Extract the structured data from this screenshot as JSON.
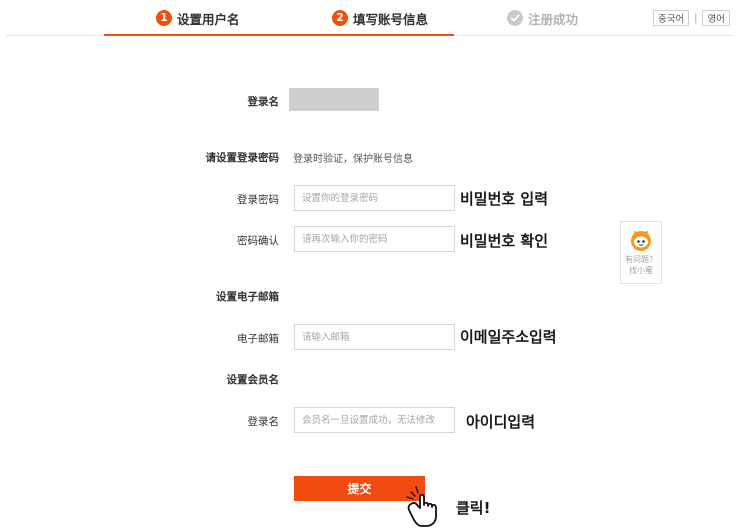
{
  "steps": [
    {
      "number": "1",
      "label": "设置用户名"
    },
    {
      "number": "2",
      "label": "填写账号信息"
    },
    {
      "label": "注册成功"
    }
  ],
  "language": {
    "option1": "중국어",
    "option2": "영어",
    "separator": "|"
  },
  "form": {
    "login_name_label": "登录名",
    "password_section_label": "请设置登录密码",
    "password_section_hint": "登录时验证，保护账号信息",
    "password_label": "登录密码",
    "password_placeholder": "设置你的登录密码",
    "confirm_label": "密码确认",
    "confirm_placeholder": "请再次输入你的密码",
    "email_section_label": "设置电子邮箱",
    "email_label": "电子邮箱",
    "email_placeholder": "请输入邮箱",
    "member_section_label": "设置会员名",
    "member_label": "登录名",
    "member_placeholder": "会员名一旦设置成功，无法修改",
    "submit_label": "提交"
  },
  "annotations": {
    "password": "비밀번호 입력",
    "confirm": "비밀번호 확인",
    "email": "이메일주소입력",
    "id": "아이디입력",
    "click": "클릭!"
  },
  "helper": {
    "line1": "有问题？",
    "line2": "找小蜜",
    "icon": "robot-face-icon"
  },
  "colors": {
    "accent": "#f0500f",
    "button": "#f24b12",
    "done_step": "#c9c9c9"
  }
}
